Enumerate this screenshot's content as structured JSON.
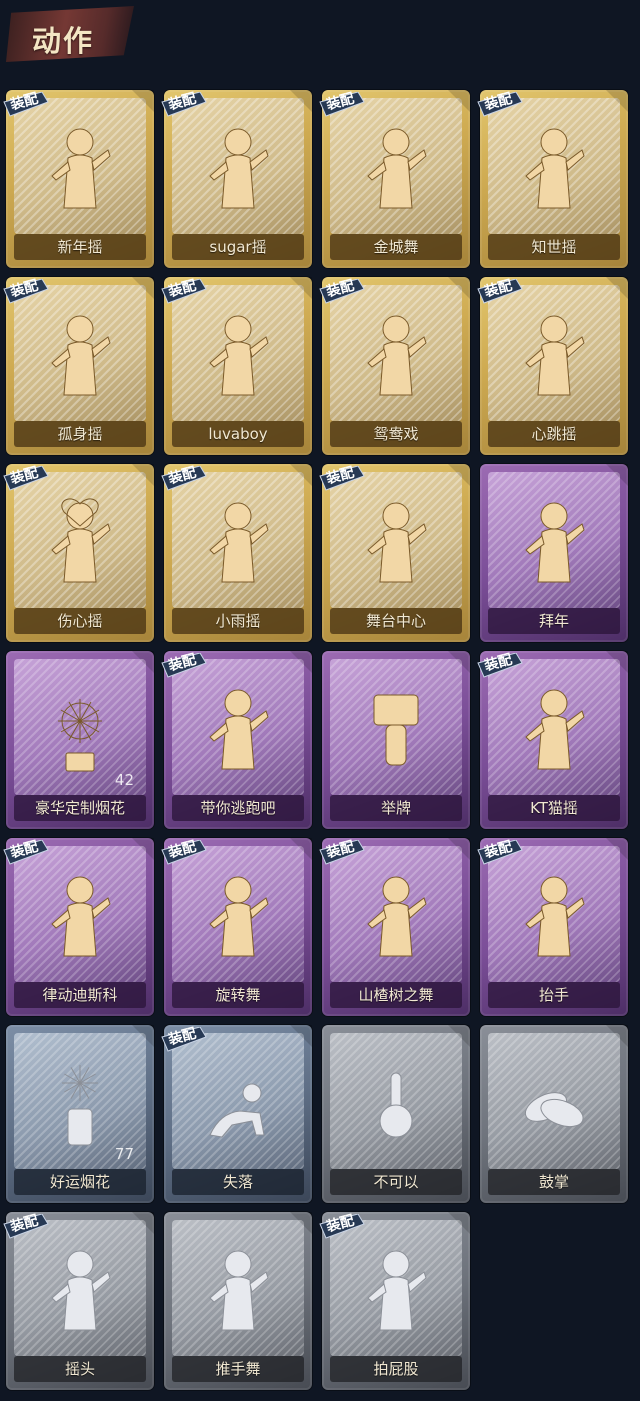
{
  "header": {
    "title": "动作"
  },
  "equipped_label": "装配",
  "tier_colors": {
    "gold": "#cfab52",
    "purple": "#7b4e98",
    "blue": "#5f6f86",
    "gray": "#6e737c"
  },
  "motions": [
    {
      "label": "新年摇",
      "tier": "gold",
      "equipped": true,
      "icon": "dancer-icon"
    },
    {
      "label": "sugar摇",
      "tier": "gold",
      "equipped": true,
      "icon": "dancer-icon"
    },
    {
      "label": "金城舞",
      "tier": "gold",
      "equipped": true,
      "icon": "dancer-icon"
    },
    {
      "label": "知世摇",
      "tier": "gold",
      "equipped": true,
      "icon": "dancer-icon"
    },
    {
      "label": "孤身摇",
      "tier": "gold",
      "equipped": true,
      "icon": "dancer-icon"
    },
    {
      "label": "luvaboy",
      "tier": "gold",
      "equipped": true,
      "icon": "dancer-icon"
    },
    {
      "label": "鸳鸯戏",
      "tier": "gold",
      "equipped": true,
      "icon": "dancer-icon"
    },
    {
      "label": "心跳摇",
      "tier": "gold",
      "equipped": true,
      "icon": "dancer-icon"
    },
    {
      "label": "伤心摇",
      "tier": "gold",
      "equipped": true,
      "icon": "heart-dancer-icon"
    },
    {
      "label": "小雨摇",
      "tier": "gold",
      "equipped": true,
      "icon": "dancer-icon"
    },
    {
      "label": "舞台中心",
      "tier": "gold",
      "equipped": true,
      "icon": "dancer-icon"
    },
    {
      "label": "拜年",
      "tier": "purple",
      "equipped": false,
      "icon": "bow-figure-icon"
    },
    {
      "label": "豪华定制烟花",
      "tier": "purple",
      "equipped": false,
      "icon": "fireworks-icon",
      "count": "42"
    },
    {
      "label": "带你逃跑吧",
      "tier": "purple",
      "equipped": true,
      "icon": "dancer-icon"
    },
    {
      "label": "举牌",
      "tier": "purple",
      "equipped": false,
      "icon": "sign-figure-icon"
    },
    {
      "label": "KT猫摇",
      "tier": "purple",
      "equipped": true,
      "icon": "dancer-icon"
    },
    {
      "label": "律动迪斯科",
      "tier": "purple",
      "equipped": true,
      "icon": "dancer-icon"
    },
    {
      "label": "旋转舞",
      "tier": "purple",
      "equipped": true,
      "icon": "dancer-icon"
    },
    {
      "label": "山楂树之舞",
      "tier": "purple",
      "equipped": true,
      "icon": "dancer-icon"
    },
    {
      "label": "抬手",
      "tier": "purple",
      "equipped": true,
      "icon": "figure-icon"
    },
    {
      "label": "好运烟花",
      "tier": "blue",
      "equipped": false,
      "icon": "firework-can-icon",
      "count": "77"
    },
    {
      "label": "失落",
      "tier": "blue",
      "equipped": true,
      "icon": "crawl-figure-icon"
    },
    {
      "label": "不可以",
      "tier": "gray",
      "equipped": false,
      "icon": "finger-icon"
    },
    {
      "label": "鼓掌",
      "tier": "gray",
      "equipped": false,
      "icon": "clap-icon"
    },
    {
      "label": "摇头",
      "tier": "gray",
      "equipped": true,
      "icon": "figure-icon"
    },
    {
      "label": "推手舞",
      "tier": "gray",
      "equipped": false,
      "icon": "figure-icon"
    },
    {
      "label": "拍屁股",
      "tier": "gray",
      "equipped": true,
      "icon": "figure-icon"
    }
  ]
}
